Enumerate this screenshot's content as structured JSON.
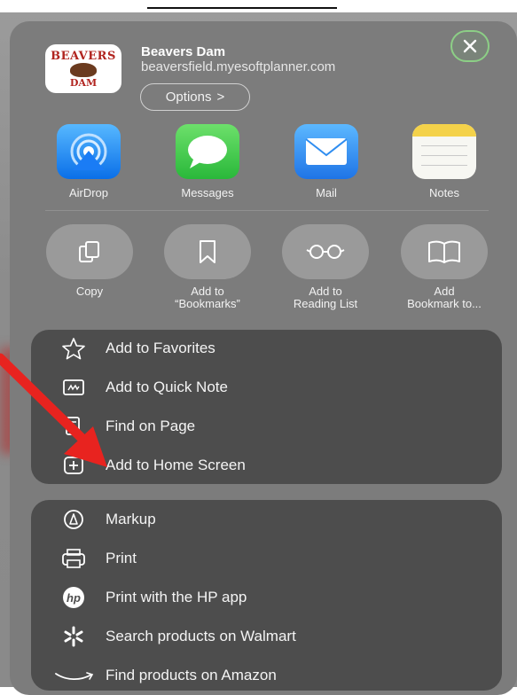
{
  "site": {
    "title": "Beavers Dam",
    "url": "beaversfield.myesoftplanner.com",
    "logo_top": "BEAVERS",
    "logo_bottom": "DAM",
    "options_label": "Options",
    "options_chevron": ">"
  },
  "apps": [
    {
      "label": "AirDrop",
      "icon": "airdrop-icon",
      "color": "#1a7cf5"
    },
    {
      "label": "Messages",
      "icon": "messages-icon",
      "color": "#39c24c"
    },
    {
      "label": "Mail",
      "icon": "mail-icon",
      "color": "#2f8df0"
    },
    {
      "label": "Notes",
      "icon": "notes-icon",
      "color": "#f2d24a"
    }
  ],
  "actions": [
    {
      "label_1": "Copy",
      "label_2": "",
      "icon": "copy-icon"
    },
    {
      "label_1": "Add to",
      "label_2": "“Bookmarks”",
      "icon": "bookmark-icon"
    },
    {
      "label_1": "Add to",
      "label_2": "Reading List",
      "icon": "glasses-icon"
    },
    {
      "label_1": "Add",
      "label_2": "Bookmark to...",
      "icon": "book-icon"
    }
  ],
  "menu_group_1": [
    {
      "label": "Add to Favorites",
      "icon": "star-icon"
    },
    {
      "label": "Add to Quick Note",
      "icon": "quick-note-icon"
    },
    {
      "label": "Find on Page",
      "icon": "find-on-page-icon"
    },
    {
      "label": "Add to Home Screen",
      "icon": "add-square-icon"
    }
  ],
  "menu_group_2": [
    {
      "label": "Markup",
      "icon": "markup-icon"
    },
    {
      "label": "Print",
      "icon": "printer-icon"
    },
    {
      "label": "Print with the HP app",
      "icon": "hp-icon"
    },
    {
      "label": "Search products on Walmart",
      "icon": "walmart-spark-icon"
    },
    {
      "label": "Find products on Amazon",
      "icon": "amazon-smile-icon"
    }
  ],
  "annotation": {
    "color": "#e8231f"
  }
}
